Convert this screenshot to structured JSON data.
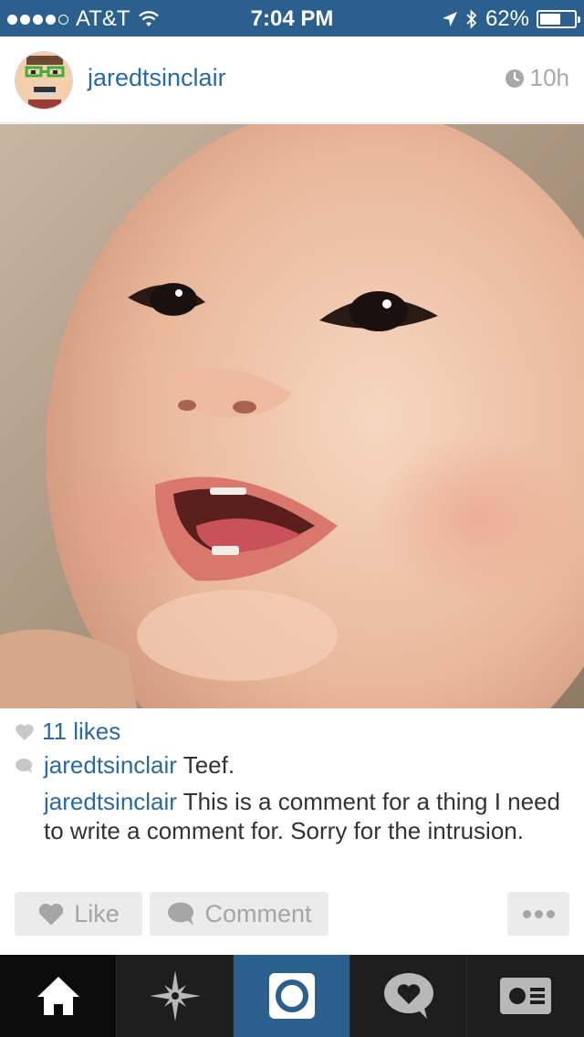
{
  "status_bar": {
    "carrier": "AT&T",
    "time": "7:04 PM",
    "battery": "62%",
    "battery_level": 0.62,
    "signal_bars": 4
  },
  "post": {
    "username": "jaredtsinclair",
    "time_ago": "10h",
    "likes": "11 likes",
    "comments": [
      {
        "user": "jaredtsinclair",
        "text": " Teef."
      },
      {
        "user": "jaredtsinclair",
        "text": " This is a comment for a thing I need to write a comment for. Sorry for the intrusion."
      }
    ]
  },
  "actions": {
    "like": "Like",
    "comment": "Comment"
  },
  "tab_bar": {
    "tabs": [
      "home",
      "explore",
      "camera",
      "activity",
      "profile"
    ],
    "active": "home"
  },
  "colors": {
    "brand_blue": "#2b5f8e",
    "link_blue": "#2a6aa0",
    "tab_bar": "#1e1e1e",
    "button_gray": "#ebebeb"
  }
}
